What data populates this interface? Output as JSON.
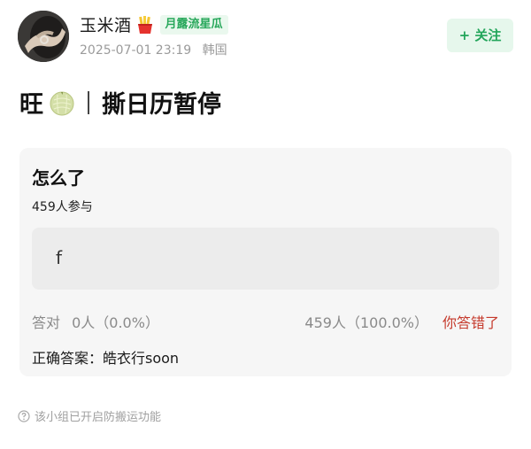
{
  "author": {
    "name": "玉米酒",
    "avatar_icon": "hand-ring-photo",
    "badge_icon": "fries-icon",
    "group_tag": "月露流星瓜",
    "date": "2025-07-01 23:19",
    "location": "韩国"
  },
  "follow": {
    "label": "+ 关注"
  },
  "post": {
    "title_prefix": "旺",
    "title_icon": "melon-icon",
    "title_text": "撕日历暂停"
  },
  "poll": {
    "question": "怎么了",
    "participants": "459人参与",
    "options": [
      {
        "label": "f"
      }
    ],
    "correct_label": "答对",
    "correct_stat": "0人（0.0%）",
    "wrong_stat": "459人（100.0%）",
    "result_label": "你答错了",
    "answer_prefix": "正确答案：",
    "answer_text": "皓衣行soon"
  },
  "notice": {
    "icon": "question-circle-icon",
    "text": "该小组已开启防搬运功能"
  },
  "colors": {
    "accent_green": "#22a55a",
    "error_red": "#c53a2c",
    "muted_gray": "#9b9b9b"
  }
}
